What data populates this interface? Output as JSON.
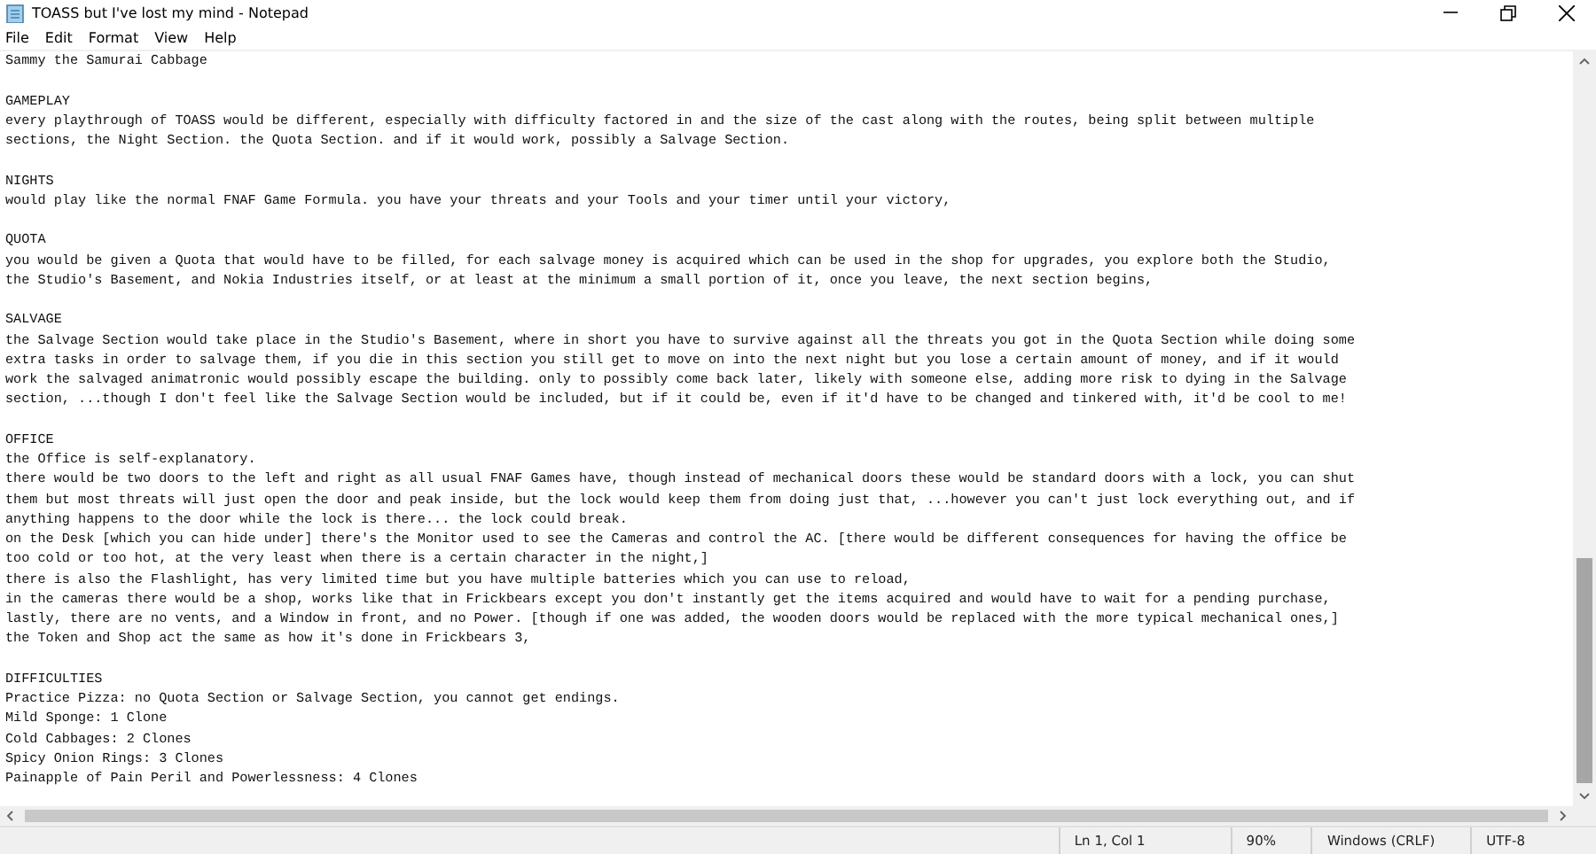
{
  "window": {
    "title": "TOASS but I've lost my mind - Notepad"
  },
  "menu": [
    "File",
    "Edit",
    "Format",
    "View",
    "Help"
  ],
  "document": {
    "first_line": "Sammy the Samurai Cabbage",
    "sections": [
      {
        "heading": "GAMEPLAY",
        "lines": [
          "every playthrough of TOASS would be different, especially with difficulty factored in and the size of the cast along with the routes, being split between multiple",
          "sections, the Night Section. the Quota Section. and if it would work, possibly a Salvage Section."
        ]
      },
      {
        "heading": "NIGHTS",
        "lines": [
          "would play like the normal FNAF Game Formula. you have your threats and your Tools and your timer until your victory,"
        ]
      },
      {
        "heading": "QUOTA",
        "lines": [
          "you would be given a Quota that would have to be filled, for each salvage money is acquired which can be used in the shop for upgrades, you explore both the Studio,",
          "the Studio's Basement, and Nokia Industries itself, or at least at the minimum a small portion of it, once you leave, the next section begins,"
        ]
      },
      {
        "heading": "SALVAGE",
        "lines": [
          "the Salvage Section would take place in the Studio's Basement, where in short you have to survive against all the threats you got in the Quota Section while doing some",
          "extra tasks in order to salvage them, if you die in this section you still get to move on into the next night but you lose a certain amount of money, and if it would",
          "work the salvaged animatronic would possibly escape the building. only to possibly come back later, likely with someone else, adding more risk to dying in the Salvage",
          "section, ...though I don't feel like the Salvage Section would be included, but if it could be, even if it'd have to be changed and tinkered with, it'd be cool to me!"
        ]
      },
      {
        "heading": "OFFICE",
        "lines": [
          "the Office is self-explanatory.",
          "there would be two doors to the left and right as all usual FNAF Games have, though instead of mechanical doors these would be standard doors with a lock, you can shut",
          "them but most threats will just open the door and peak inside, but the lock would keep them from doing just that, ...however you can't just lock everything out, and if",
          "anything happens to the door while the lock is there... the lock could break.",
          "on the Desk [which you can hide under] there's the Monitor used to see the Cameras and control the AC. [there would be different consequences for having the office be",
          "too cold or too hot, at the very least when there is a certain character in the night,]",
          "there is also the Flashlight, has very limited time but you have multiple batteries which you can use to reload,",
          "in the cameras there would be a shop, works like that in Frickbears except you don't instantly get the items acquired and would have to wait for a pending purchase,",
          "lastly, there are no vents, and a Window in front, and no Power. [though if one was added, the wooden doors would be replaced with the more typical mechanical ones,]",
          "the Token and Shop act the same as how it's done in Frickbears 3,"
        ]
      },
      {
        "heading": "DIFFICULTIES",
        "lines": [
          "Practice Pizza: no Quota Section or Salvage Section, you cannot get endings.",
          "Mild Sponge: 1 Clone",
          "Cold Cabbages: 2 Clones",
          "Spicy Onion Rings: 3 Clones",
          "Painapple of Pain Peril and Powerlessness: 4 Clones"
        ]
      }
    ]
  },
  "status_bar": [
    "Ln 1, Col 1",
    "90%",
    "Windows (CRLF)",
    "UTF-8"
  ]
}
